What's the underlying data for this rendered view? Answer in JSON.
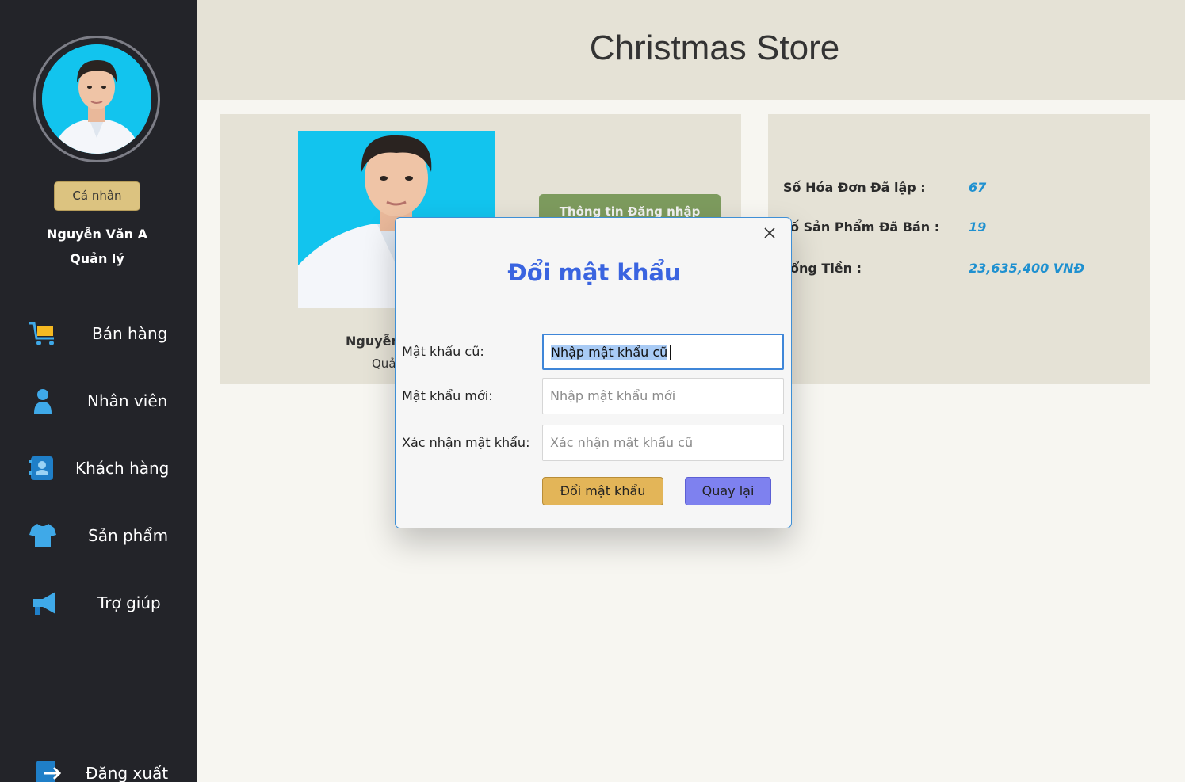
{
  "app": {
    "title": "Christmas Store"
  },
  "sidebar": {
    "profile_button": "Cá nhân",
    "user_name": "Nguyễn Văn A",
    "user_role": "Quản lý",
    "items": [
      {
        "label": "Bán hàng",
        "icon": "cart-icon"
      },
      {
        "label": "Nhân viên",
        "icon": "person-icon"
      },
      {
        "label": "Khách hàng",
        "icon": "contact-icon"
      },
      {
        "label": "Sản phẩm",
        "icon": "shirt-icon"
      },
      {
        "label": "Trợ giúp",
        "icon": "megaphone-icon"
      }
    ],
    "logout": {
      "label": "Đăng xuất",
      "icon": "logout-icon"
    }
  },
  "profile_panel": {
    "login_info_button": "Thông tin Đăng nhập",
    "name": "Nguyễn",
    "role": "Quả"
  },
  "stats": {
    "invoices_label": "Số Hóa Đơn Đã lập :",
    "invoices_value": "67",
    "products_label": "ố Sản Phẩm Đã Bán :",
    "products_value": "19",
    "total_label": "ổng Tiền :",
    "total_value": "23,635,400 VNĐ"
  },
  "dialog": {
    "title": "Đổi mật khẩu",
    "old_password_label": "Mật khẩu cũ:",
    "old_password_value": "Nhập mật khẩu cũ",
    "new_password_label": "Mật khẩu mới:",
    "new_password_placeholder": "Nhập mật khẩu mới",
    "confirm_label": "Xác nhận mật khẩu:",
    "confirm_placeholder": "Xác nhận mật khẩu cũ",
    "submit_button": "Đổi mật khẩu",
    "back_button": "Quay lại"
  },
  "colors": {
    "sidebar_bg": "#232429",
    "header_bg": "#e5e2d6",
    "accent_blue": "#3a64e0",
    "stat_value": "#1e90d0",
    "submit_button": "#e3b558",
    "back_button": "#7e81ef"
  }
}
